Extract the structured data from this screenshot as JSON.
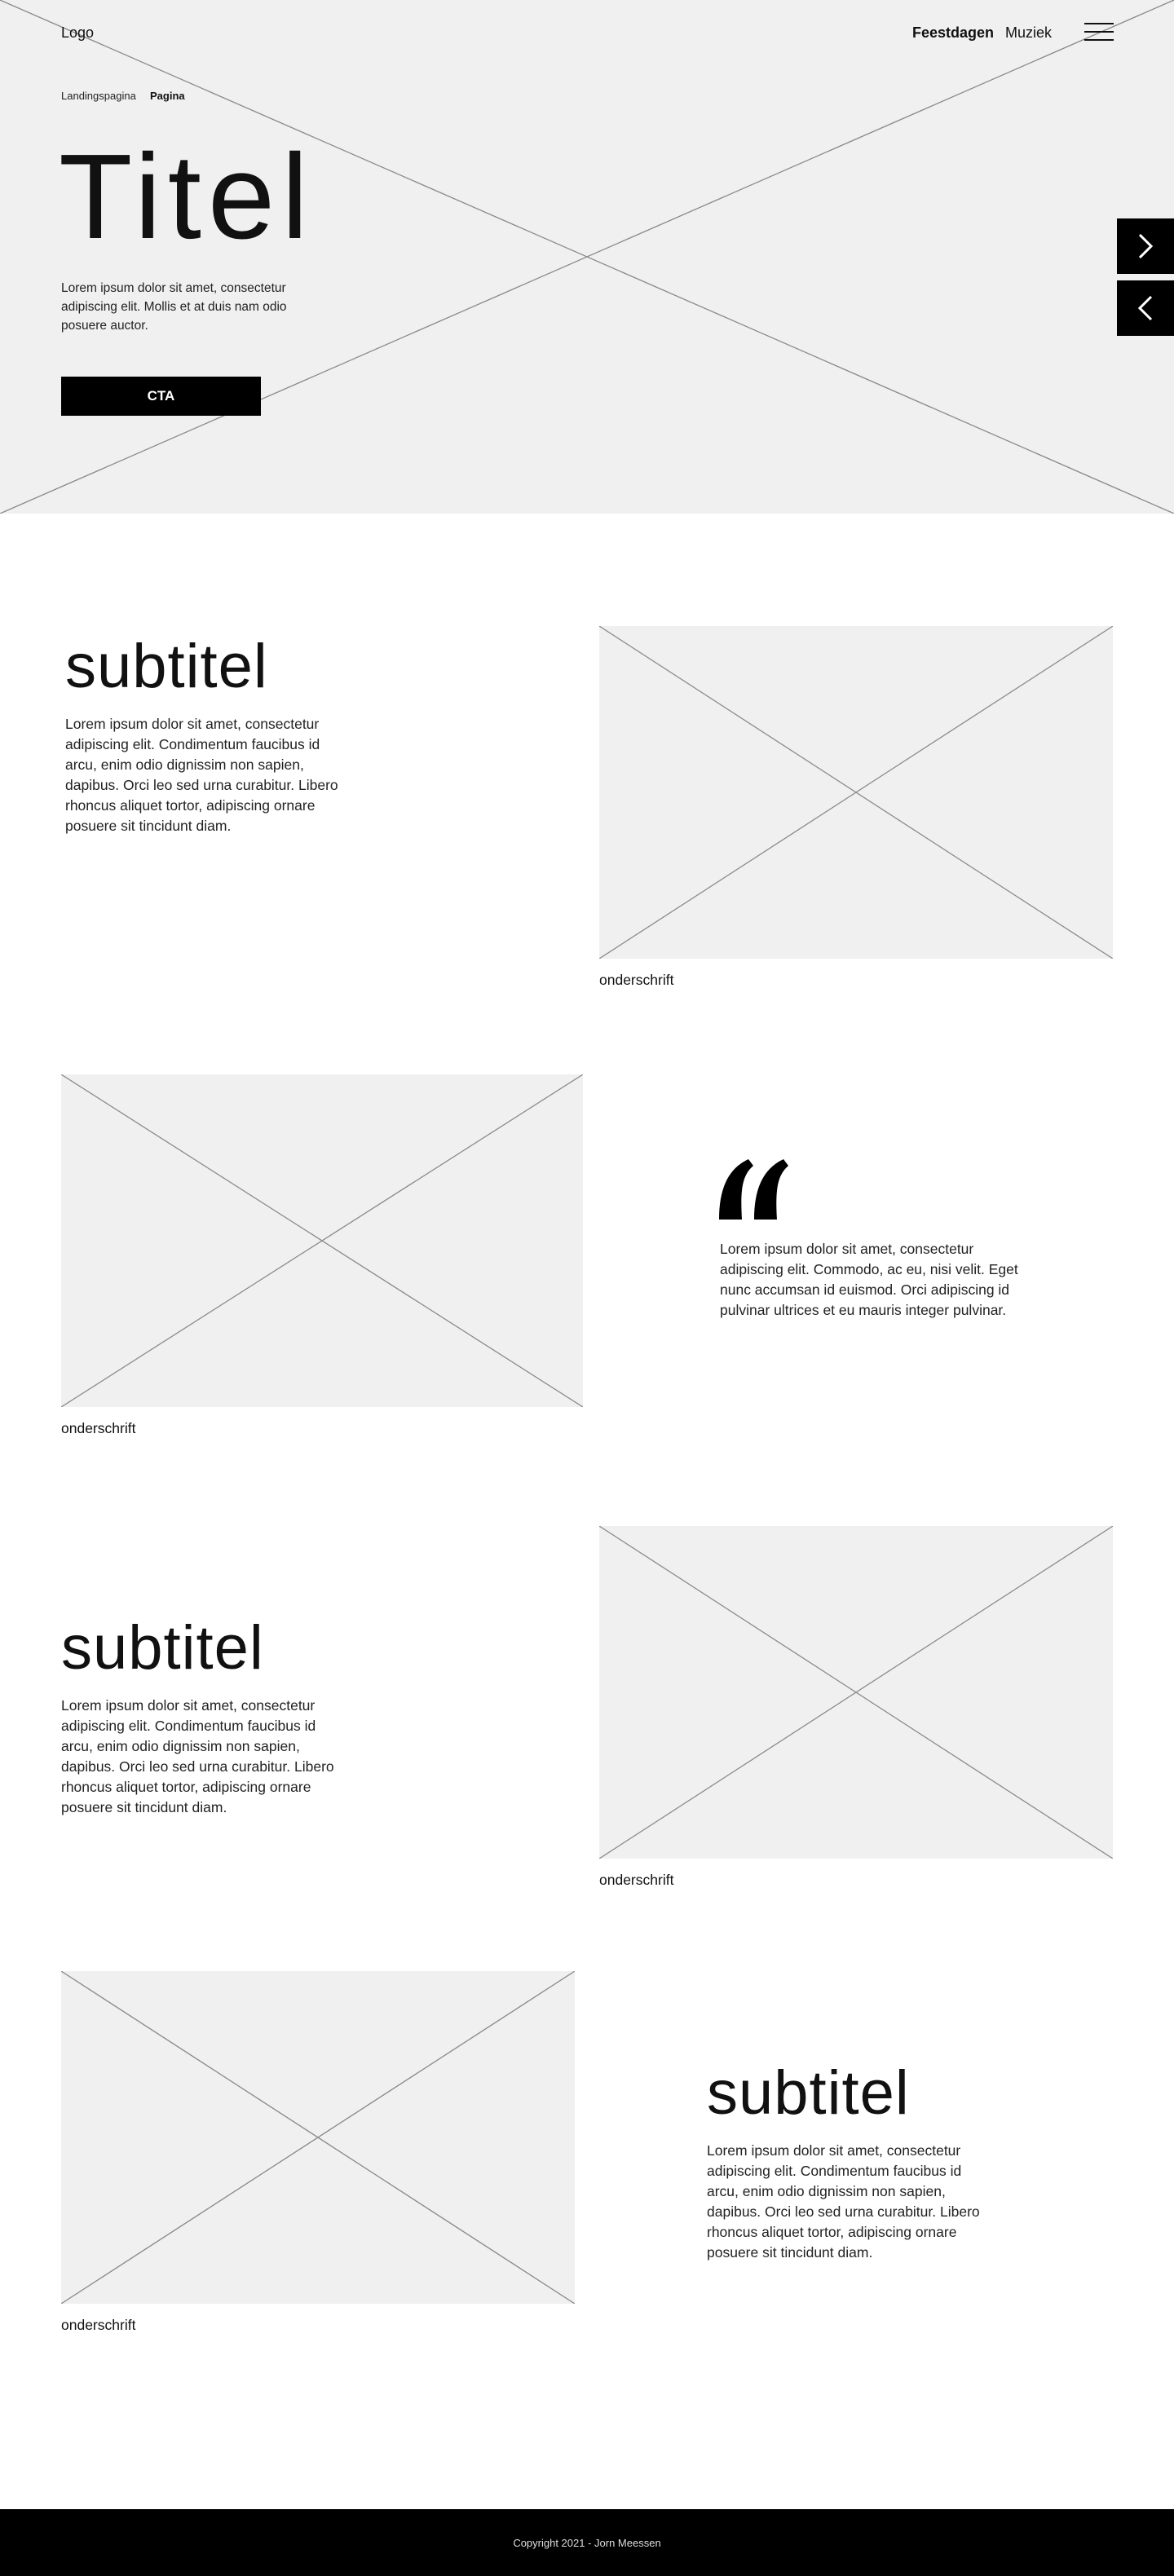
{
  "header": {
    "logo": "Logo",
    "nav": [
      "Feestdagen",
      "Muziek"
    ],
    "menu_icon": "hamburger-menu-icon"
  },
  "breadcrumb": [
    "Landingspagina",
    "Pagina"
  ],
  "hero": {
    "title": "Titel",
    "text": "Lorem ipsum dolor sit amet, consectetur adipiscing elit. Mollis et at duis nam odio posuere auctor.",
    "cta": "CTA",
    "next_icon": "chevron-right-icon",
    "prev_icon": "chevron-left-icon"
  },
  "sections": [
    {
      "subtitle": "subtitel",
      "text": "Lorem ipsum dolor sit amet, consectetur adipiscing elit. Condimentum faucibus id arcu, enim odio dignissim non sapien, dapibus. Orci leo sed urna curabitur. Libero rhoncus aliquet tortor, adipiscing ornare posuere sit tincidunt diam.",
      "caption": "onderschrift"
    },
    {
      "caption": "onderschrift",
      "quote_icon": "quote-icon",
      "quote": "Lorem ipsum dolor sit amet, consectetur adipiscing elit. Commodo, ac eu, nisi velit. Eget nunc accumsan id euismod. Orci adipiscing id pulvinar ultrices et eu mauris integer pulvinar."
    },
    {
      "subtitle": "subtitel",
      "text": "Lorem ipsum dolor sit amet, consectetur adipiscing elit. Condimentum faucibus id arcu, enim odio dignissim non sapien, dapibus. Orci leo sed urna curabitur. Libero rhoncus aliquet tortor, adipiscing ornare posuere sit tincidunt diam.",
      "caption": "onderschrift"
    },
    {
      "caption": "onderschrift",
      "subtitle": "subtitel",
      "text": "Lorem ipsum dolor sit amet, consectetur adipiscing elit. Condimentum faucibus id arcu, enim odio dignissim non sapien, dapibus. Orci leo sed urna curabitur. Libero rhoncus aliquet tortor, adipiscing ornare posuere sit tincidunt diam."
    }
  ],
  "footer": {
    "copyright": "Copyright 2021 - Jorn Meessen"
  },
  "colors": {
    "placeholder_bg": "#f0f0f0",
    "placeholder_line": "#8a8a8a",
    "accent": "#000000",
    "footer_bg": "#000000"
  }
}
